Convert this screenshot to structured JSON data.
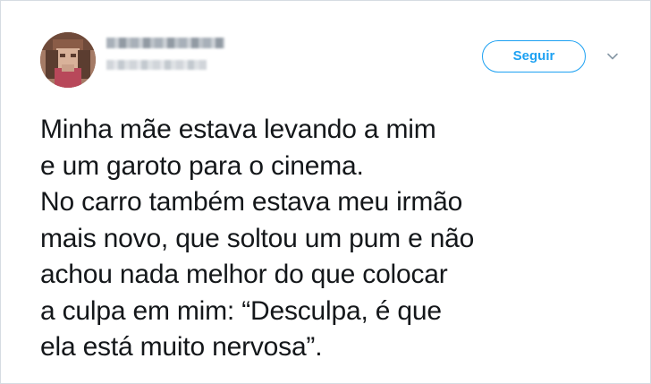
{
  "tweet": {
    "follow_label": "Seguir",
    "caret_icon": "chevron-down-icon",
    "avatar_icon": "avatar",
    "text_lines": [
      "Minha mãe estava levando a mim",
      "e um garoto para o cinema.",
      "No carro também estava meu irmão",
      "mais novo, que soltou um pum e não",
      "achou nada melhor do que colocar",
      "a culpa em mim: “Desculpa, é que",
      "ela está muito nervosa”."
    ]
  },
  "colors": {
    "accent": "#1da1f2",
    "text": "#14171a",
    "border": "#d6dce2"
  }
}
